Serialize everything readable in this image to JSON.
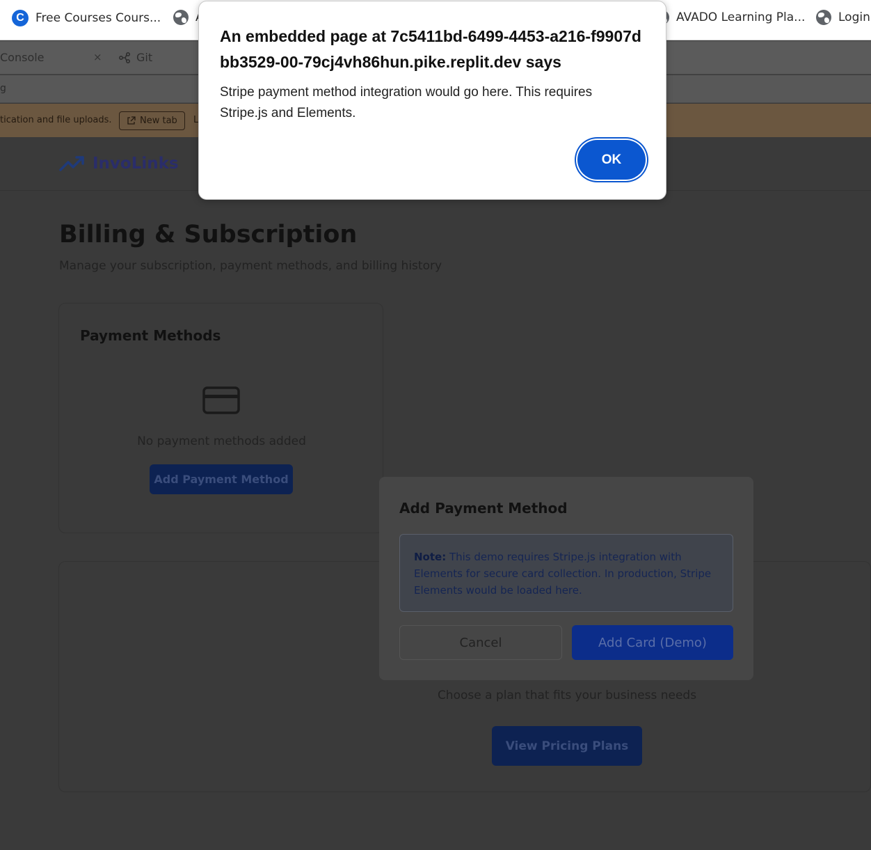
{
  "bookmarks": {
    "items": [
      {
        "label": "Free Courses Cours...",
        "icon": "c-logo-icon"
      },
      {
        "label": "A",
        "icon": "globe-icon"
      },
      {
        "label": "AVADO Learning Pla...",
        "icon": "globe-icon"
      },
      {
        "label": "Login",
        "icon": "globe-icon"
      }
    ]
  },
  "tabs": {
    "console": "Console",
    "close": "×",
    "git": "Git"
  },
  "url_fragment": "g",
  "warning": {
    "message": "tication and file uploads.",
    "new_tab": "New tab",
    "extra": "L"
  },
  "app": {
    "brand": "InvoLinks",
    "page_title": "Billing & Subscription",
    "page_subtitle": "Manage your subscription, payment methods, and billing history"
  },
  "payment_methods": {
    "title": "Payment Methods",
    "empty_text": "No payment methods added",
    "add_button": "Add Payment Method"
  },
  "plans": {
    "description": "Choose a plan that fits your business needs",
    "view_button": "View Pricing Plans"
  },
  "modal": {
    "title": "Add Payment Method",
    "note_label": "Note:",
    "note_text": " This demo requires Stripe.js integration with Elements for secure card collection. In production, Stripe Elements would be loaded here.",
    "cancel": "Cancel",
    "add_card": "Add Card (Demo)"
  },
  "alert": {
    "title": "An embedded page at 7c5411bd-6499-4453-a216-f9907dbb3529-00-79cj4vh86hun.pike.replit.dev says",
    "message": "Stripe payment method integration would go here. This requires Stripe.js and Elements.",
    "ok": "OK"
  },
  "colors": {
    "alert_button": "#0b57d0",
    "brand_dim": "#2a2d6a",
    "primary_dim": "#0d2252"
  }
}
